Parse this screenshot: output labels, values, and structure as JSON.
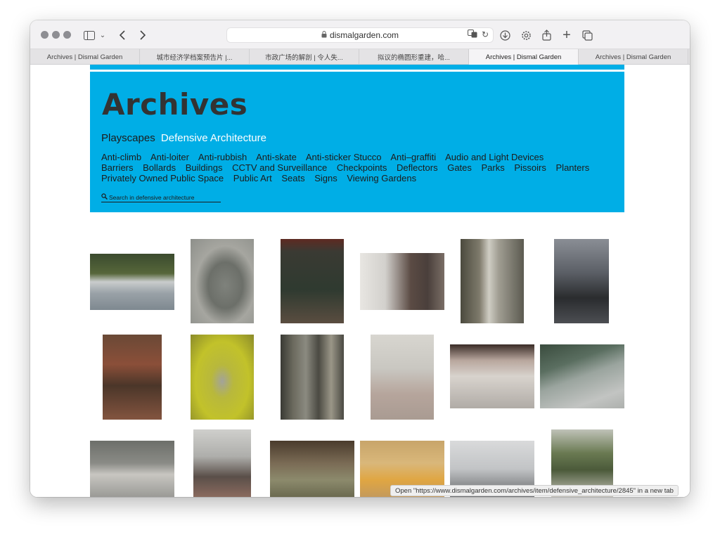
{
  "browser": {
    "address": "dismalgarden.com",
    "tabs": [
      "Archives | Dismal Garden",
      "城市经济学档案预告片 |...",
      "市政广场的解剖 | 令人失...",
      "拟议的椭圆形重建，哈...",
      "Archives | Dismal Garden",
      "Archives | Dismal Garden"
    ],
    "active_tab_index": 4,
    "status_text": "Open \"https://www.dismalgarden.com/archives/item/defensive_architecture/2845\" in a new tab"
  },
  "page": {
    "title": "Archives",
    "breadcrumb": {
      "parent": "Playscapes",
      "current": "Defensive Architecture"
    },
    "categories": [
      "Anti-climb",
      "Anti-loiter",
      "Anti-rubbish",
      "Anti-skate",
      "Anti-sticker Stucco",
      "Anti–graffiti",
      "Audio and Light Devices",
      "Barriers",
      "Bollards",
      "Buildings",
      "CCTV and Surveillance",
      "Checkpoints",
      "Deflectors",
      "Gates",
      "Parks",
      "Pissoirs",
      "Planters",
      "Privately Owned Public Space",
      "Public Art",
      "Seats",
      "Signs",
      "Viewing Gardens"
    ],
    "search_placeholder": "Search in defensive architecture",
    "accent_color": "#00aee6",
    "title_color": "#333333"
  },
  "photos": [
    {
      "name": "photo-planter-ledge"
    },
    {
      "name": "photo-concrete-bollard-seats"
    },
    {
      "name": "photo-welcome-plaque"
    },
    {
      "name": "photo-railing-ledge"
    },
    {
      "name": "photo-lamp-post"
    },
    {
      "name": "photo-crossing-post"
    },
    {
      "name": "photo-courtyard-fountain"
    },
    {
      "name": "photo-yellow-tiled-corner"
    },
    {
      "name": "photo-metal-gate"
    },
    {
      "name": "photo-spiked-doorway"
    },
    {
      "name": "photo-white-bollards"
    },
    {
      "name": "photo-paved-corner"
    },
    {
      "name": "photo-street-barrier-blocks"
    },
    {
      "name": "photo-city-street"
    },
    {
      "name": "photo-metal-studs-ledge"
    },
    {
      "name": "photo-orange-bench"
    },
    {
      "name": "photo-white-building"
    },
    {
      "name": "photo-garden-railings"
    }
  ]
}
